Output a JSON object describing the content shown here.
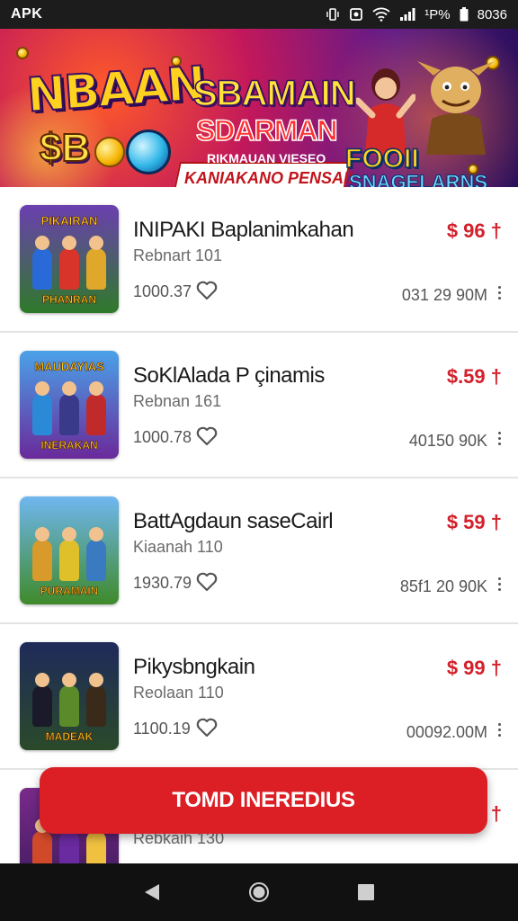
{
  "status_bar": {
    "left_label": "APK",
    "signal_text": "¹P%",
    "time": "8036",
    "icons": [
      "vibrate-icon",
      "alarm-icon",
      "wifi-icon",
      "signal-icon",
      "battery-icon"
    ]
  },
  "banner": {
    "title": "NBAAN",
    "money": "$B",
    "headline": "SBAMAIN",
    "headline2": "SDARMAN",
    "ribbon_small": "RIKMAUAN VIESEO",
    "ribbon_text": "KANIAKANO PENSAII",
    "logo": "FOOII",
    "logo_small": "SNAGELARNS"
  },
  "items": [
    {
      "title": "INIPAKI Baplanimkahan",
      "subtitle": "Rebnart 101",
      "date": "1000.37",
      "price": "$ 96 †",
      "size": "031 29 90M",
      "thumb": {
        "top": "#6b3fb0",
        "bottom": "#2f7a2a",
        "ttl": "PIKAIRAN",
        "bttl": "PHANRAN"
      }
    },
    {
      "title": "SoKlAlada P çinamis",
      "subtitle": "Rebnan 161",
      "date": "1000.78",
      "price": "$.59 †",
      "size": "40150 90K",
      "thumb": {
        "top": "#4aa2e8",
        "bottom": "#6a2a9a",
        "ttl": "MAUDAYIAS",
        "bttl": "INERAKAN"
      }
    },
    {
      "title": "BattAgdaun saseCairl",
      "subtitle": "Kiaanah 110",
      "date": "1930.79",
      "price": "$ 59 †",
      "size": "85f1 20 90K",
      "thumb": {
        "top": "#6fb7f0",
        "bottom": "#3f8a2a",
        "ttl": "",
        "bttl": "PURAMAIN"
      }
    },
    {
      "title": "Pikysbngkain",
      "subtitle": "Reolaan 110",
      "date": "1100.19",
      "price": "$ 99 †",
      "size": "00092.00M",
      "thumb": {
        "top": "#1f2a5a",
        "bottom": "#2a4a2a",
        "ttl": "",
        "bttl": "MADEAK"
      }
    },
    {
      "title": "",
      "subtitle": "Rebkaih 130",
      "date": "",
      "price": "†",
      "size": "",
      "thumb": {
        "top": "#7a2a8a",
        "bottom": "#3a1a5a",
        "ttl": "",
        "bttl": ""
      }
    }
  ],
  "cta": {
    "label": "TOMD INEREDIUS"
  },
  "colors": {
    "accent": "#db1f25",
    "price": "#d3202a"
  },
  "navbar": {
    "icons": [
      "back-icon",
      "home-icon",
      "recents-icon"
    ]
  }
}
